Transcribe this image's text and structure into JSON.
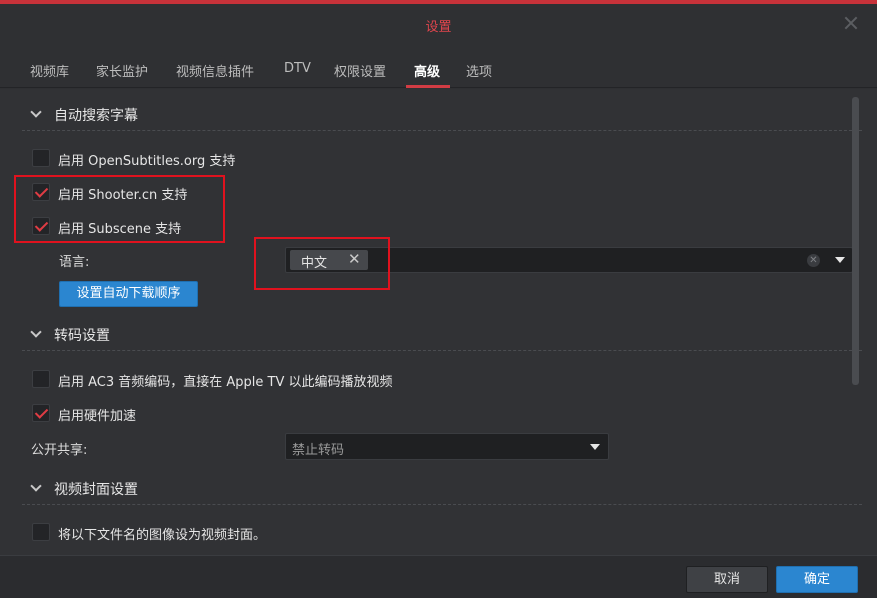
{
  "window": {
    "title": "设置"
  },
  "tabs": [
    {
      "label": "视频库"
    },
    {
      "label": "家长监护"
    },
    {
      "label": "视频信息插件"
    },
    {
      "label": "DTV"
    },
    {
      "label": "权限设置"
    },
    {
      "label": "高级"
    },
    {
      "label": "选项"
    }
  ],
  "active_tab": "高级",
  "sections": {
    "subtitles": {
      "title": "自动搜索字幕",
      "opensubtitles": {
        "label": "启用 OpenSubtitles.org 支持",
        "checked": false
      },
      "shooter": {
        "label": "启用 Shooter.cn 支持",
        "checked": true
      },
      "subscene": {
        "label": "启用 Subscene 支持",
        "checked": true
      },
      "language_label": "语言:",
      "language_tag": "中文",
      "download_order_button": "设置自动下载顺序"
    },
    "transcode": {
      "title": "转码设置",
      "ac3": {
        "label": "启用 AC3 音频编码，直接在 Apple TV 以此编码播放视频",
        "checked": false
      },
      "hwaccel": {
        "label": "启用硬件加速",
        "checked": true
      },
      "public_share_label": "公开共享:",
      "public_share_value": "禁止转码"
    },
    "cover": {
      "title": "视频封面设置",
      "filename_cover": {
        "label": "将以下文件名的图像设为视频封面。",
        "checked": false
      }
    }
  },
  "footer": {
    "cancel_label": "取消",
    "ok_label": "确定"
  },
  "colors": {
    "accent_red": "#d23c44",
    "primary_blue": "#2b86d0",
    "annotation_red": "#e0121e"
  },
  "icons": {
    "close": "close-icon",
    "chevron": "chevron-down-icon",
    "remove_tag": "remove-tag-icon",
    "clear": "clear-icon",
    "dropdown": "dropdown-caret-icon",
    "check": "checkmark-icon"
  }
}
